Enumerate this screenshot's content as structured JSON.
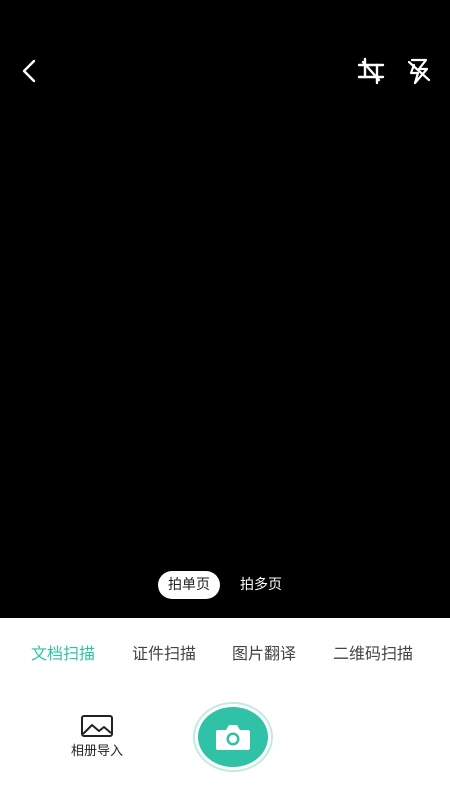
{
  "top_bar": {
    "back_icon": "chevron-left-icon",
    "crop_icon": "crop-icon",
    "flash_icon": "flash-off-icon"
  },
  "capture_mode": {
    "options": [
      "拍单页",
      "拍多页"
    ],
    "selected": "拍单页"
  },
  "scan_tabs": {
    "items": [
      "文档扫描",
      "证件扫描",
      "图片翻译",
      "二维码扫描"
    ],
    "selected": "文档扫描"
  },
  "album_import": {
    "label": "相册导入",
    "icon": "image-icon"
  },
  "shutter": {
    "icon": "camera-icon"
  },
  "colors": {
    "accent": "#2fc2a6",
    "viewfinder_bg": "#000000",
    "panel_bg": "#ffffff"
  }
}
